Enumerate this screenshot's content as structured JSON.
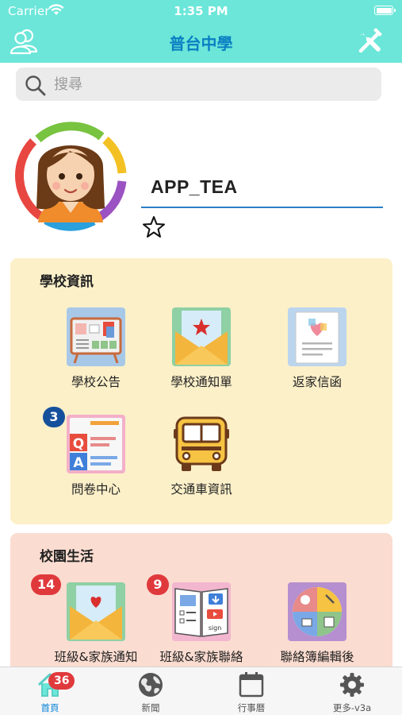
{
  "status_bar": {
    "carrier": "Carrier",
    "time": "1:35 PM"
  },
  "nav": {
    "title": "普台中學",
    "left_icon": "users-icon",
    "right_icon": "tools-icon"
  },
  "search": {
    "placeholder": "搜尋",
    "value": ""
  },
  "profile": {
    "username": "APP_TEA",
    "favorite_icon": "star-outline-icon"
  },
  "school_info": {
    "title": "學校資訊",
    "items": [
      {
        "label": "學校公告",
        "icon": "bulletin-board-icon"
      },
      {
        "label": "學校通知單",
        "icon": "envelope-star-icon"
      },
      {
        "label": "返家信函",
        "icon": "letter-heart-icon"
      },
      {
        "label": "問卷中心",
        "icon": "qa-survey-icon",
        "badge": "3"
      },
      {
        "label": "交通車資訊",
        "icon": "school-bus-icon"
      }
    ]
  },
  "campus_life": {
    "title": "校園生活",
    "items": [
      {
        "label": "班級&家族通知",
        "icon": "envelope-heart-icon",
        "badge": "14"
      },
      {
        "label": "班級&家族聯絡",
        "icon": "open-book-icon",
        "badge": "9"
      },
      {
        "label": "聯絡簿編輯後",
        "icon": "contact-book-icon"
      }
    ]
  },
  "tabs": [
    {
      "label": "首頁",
      "icon": "home-icon",
      "badge": "36",
      "active": true
    },
    {
      "label": "新聞",
      "icon": "globe-icon"
    },
    {
      "label": "行事曆",
      "icon": "calendar-icon"
    },
    {
      "label": "更多-v3a",
      "icon": "gear-icon"
    }
  ],
  "colors": {
    "header": "#6be6d9",
    "title": "#0a7fc2",
    "school_card": "#fcf0c9",
    "life_card": "#fbdcd0",
    "badge_red": "#e0393c",
    "badge_blue": "#15509c"
  }
}
